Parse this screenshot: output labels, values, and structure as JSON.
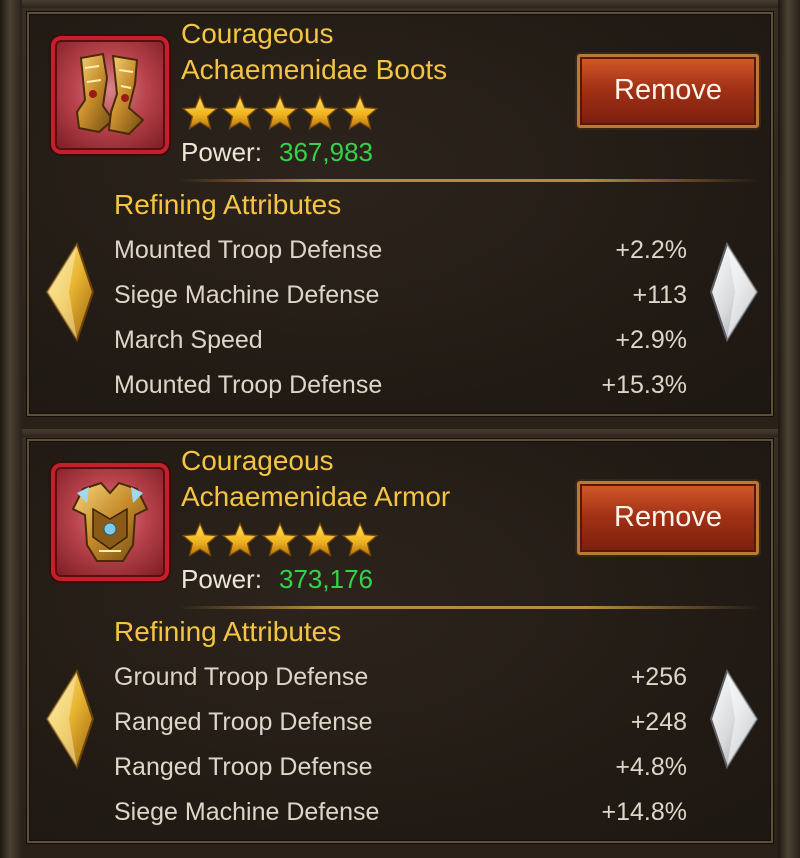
{
  "items": [
    {
      "title_line1": "Courageous",
      "title_line2": "Achaemenidae Boots",
      "icon": "boots-icon",
      "stars": 5,
      "power_label": "Power:",
      "power_value": "367,983",
      "remove_label": "Remove",
      "section_title": "Refining Attributes",
      "attributes": [
        {
          "name": "Mounted Troop Defense",
          "value": "+2.2%"
        },
        {
          "name": "Siege Machine Defense",
          "value": "+113"
        },
        {
          "name": "March Speed",
          "value": "+2.9%"
        },
        {
          "name": "Mounted Troop Defense",
          "value": "+15.3%"
        }
      ]
    },
    {
      "title_line1": "Courageous",
      "title_line2": "Achaemenidae Armor",
      "icon": "armor-icon",
      "stars": 5,
      "power_label": "Power:",
      "power_value": "373,176",
      "remove_label": "Remove",
      "section_title": "Refining Attributes",
      "attributes": [
        {
          "name": "Ground Troop Defense",
          "value": "+256"
        },
        {
          "name": "Ranged Troop Defense",
          "value": "+248"
        },
        {
          "name": "Ranged Troop Defense",
          "value": "+4.8%"
        },
        {
          "name": "Siege Machine Defense",
          "value": "+14.8%"
        }
      ]
    }
  ],
  "colors": {
    "title_gold": "#f4c443",
    "power_green": "#33d34a",
    "icon_border_red": "#c2202a",
    "button_red": "#a33216"
  },
  "arrows": {
    "left": "gold-diamond-left-arrow-icon",
    "right": "silver-diamond-right-arrow-icon"
  }
}
